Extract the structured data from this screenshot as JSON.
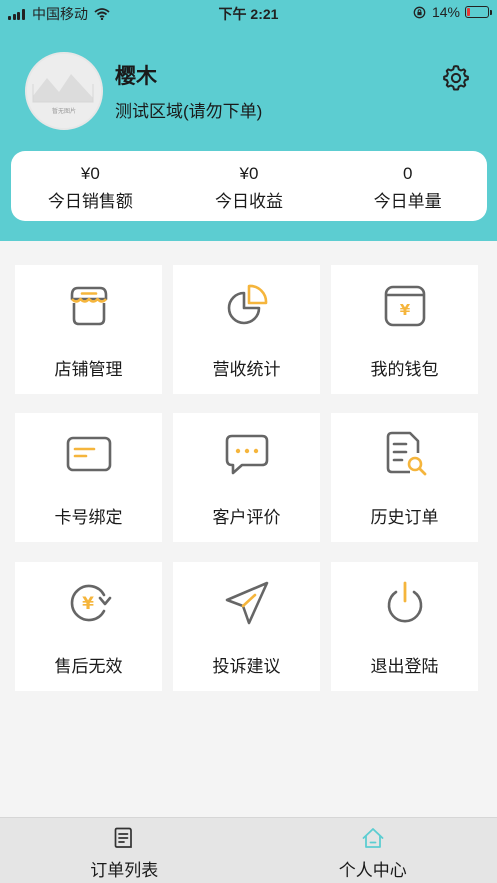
{
  "status_bar": {
    "carrier": "中国移动",
    "time": "下午 2:21",
    "battery": "14%",
    "battery_level": 0.14,
    "icons": [
      "signal-icon",
      "wifi-icon",
      "rotation-lock-icon",
      "battery-icon"
    ]
  },
  "profile": {
    "name": "樱木",
    "region": "测试区域(请勿下单)",
    "avatar_caption": "暂无图片",
    "settings_icon": "gear-icon"
  },
  "stats": [
    {
      "value": "¥0",
      "label": "今日销售额"
    },
    {
      "value": "¥0",
      "label": "今日收益"
    },
    {
      "value": "0",
      "label": "今日单量"
    }
  ],
  "menu": [
    {
      "label": "店铺管理",
      "icon": "store-icon"
    },
    {
      "label": "营收统计",
      "icon": "pie-chart-icon"
    },
    {
      "label": "我的钱包",
      "icon": "wallet-icon"
    },
    {
      "label": "卡号绑定",
      "icon": "bank-card-icon"
    },
    {
      "label": "客户评价",
      "icon": "chat-bubble-icon"
    },
    {
      "label": "历史订单",
      "icon": "document-search-icon"
    },
    {
      "label": "售后无效",
      "icon": "refund-icon"
    },
    {
      "label": "投诉建议",
      "icon": "paper-plane-icon"
    },
    {
      "label": "退出登陆",
      "icon": "power-icon"
    }
  ],
  "tabbar": [
    {
      "label": "订单列表",
      "icon": "order-list-icon",
      "active": false
    },
    {
      "label": "个人中心",
      "icon": "home-icon",
      "active": true
    }
  ],
  "colors": {
    "header_bg": "#5ccdd1",
    "accent": "#f5b53c",
    "icon_gray": "#666666",
    "active_tab": "#5ccdd1"
  }
}
